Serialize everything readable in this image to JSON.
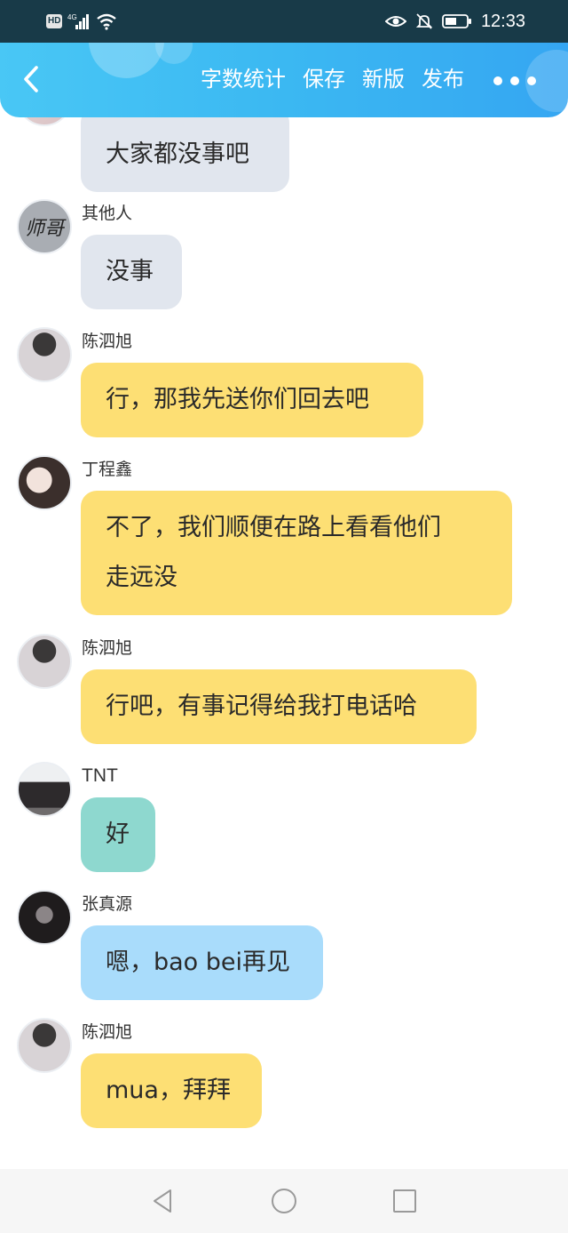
{
  "status_bar": {
    "network_badge": "HD",
    "signal_label": "4G",
    "time": "12:33",
    "icons": [
      "hd-icon",
      "signal-icon",
      "wifi-icon",
      "eye-icon",
      "bell-off-icon",
      "battery-icon"
    ]
  },
  "header": {
    "back_icon": "chevron-left-icon",
    "actions": [
      "字数统计",
      "保存",
      "新版",
      "发布"
    ],
    "more_icon": "more-dots-icon",
    "accent_color": "#3bb8f2"
  },
  "messages": [
    {
      "sender": "",
      "text": "大家都没事吧",
      "color": "gray"
    },
    {
      "sender": "其他人",
      "avatar_text": "师哥",
      "text": "没事",
      "color": "gray"
    },
    {
      "sender": "陈泗旭",
      "text": "行，那我先送你们回去吧",
      "color": "yellow"
    },
    {
      "sender": "丁程鑫",
      "text_line1": "不了，我们顺便在路上看看他们",
      "text_line2": "走远没",
      "color": "yellow"
    },
    {
      "sender": "陈泗旭",
      "text": "行吧，有事记得给我打电话哈",
      "color": "yellow"
    },
    {
      "sender": "TNT",
      "text": "好",
      "color": "teal"
    },
    {
      "sender": "张真源",
      "text": "嗯，bao bei再见",
      "color": "blue"
    },
    {
      "sender": "陈泗旭",
      "text": "mua，拜拜",
      "color": "yellow"
    }
  ],
  "bubble_colors": {
    "gray": "#e1e6ee",
    "yellow": "#fddf74",
    "teal": "#8ed8cf",
    "blue": "#a9dcfb"
  },
  "nav_bar": {
    "icons": [
      "back-triangle-icon",
      "home-circle-icon",
      "recents-square-icon"
    ]
  }
}
